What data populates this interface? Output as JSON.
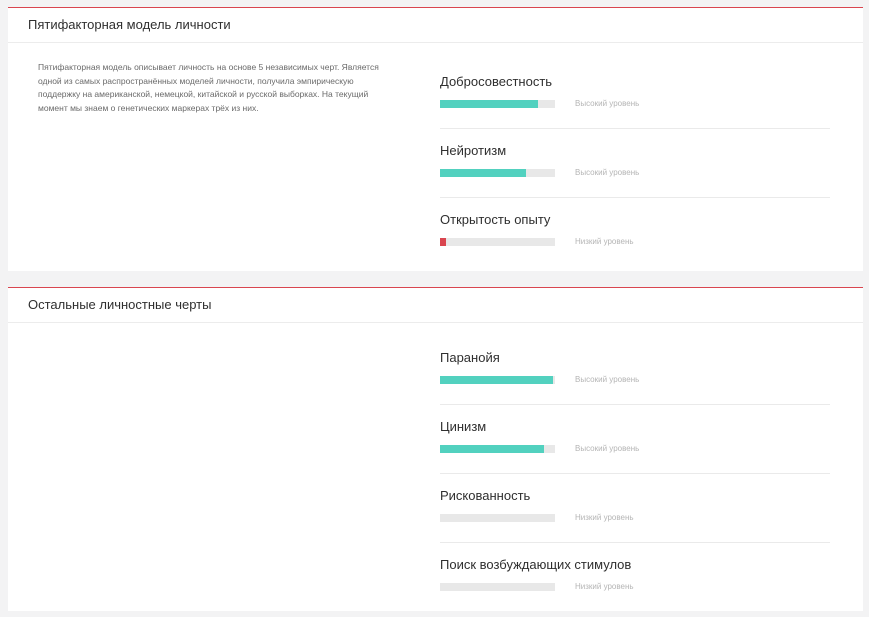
{
  "colors": {
    "accent_line": "#d9454f",
    "high": "#52d1bf",
    "low": "#d9454f",
    "track": "#e8e8e8"
  },
  "sections": [
    {
      "title": "Пятифакторная модель личности",
      "description": "Пятифакторная модель описывает личность на основе 5 независимых черт. Является одной из самых распространённых моделей личности, получила эмпирическую поддержку на американской, немецкой, китайской и русской выборках. На текущий момент мы знаем о генетических маркерах трёх из них.",
      "traits": [
        {
          "name": "Добросовестность",
          "level": "Высокий уровень",
          "fill": 0.85,
          "color": "#52d1bf"
        },
        {
          "name": "Нейротизм",
          "level": "Высокий уровень",
          "fill": 0.75,
          "color": "#52d1bf"
        },
        {
          "name": "Открытость опыту",
          "level": "Низкий уровень",
          "fill": 0.05,
          "color": "#d9454f"
        }
      ]
    },
    {
      "title": "Остальные личностные черты",
      "traits": [
        {
          "name": "Паранойя",
          "level": "Высокий уровень",
          "fill": 0.98,
          "color": "#52d1bf"
        },
        {
          "name": "Цинизм",
          "level": "Высокий уровень",
          "fill": 0.9,
          "color": "#52d1bf"
        },
        {
          "name": "Рискованность",
          "level": "Низкий уровень",
          "fill": 0,
          "color": "#d9454f"
        },
        {
          "name": "Поиск возбуждающих стимулов",
          "level": "Низкий уровень",
          "fill": 0,
          "color": "#d9454f"
        }
      ]
    }
  ]
}
